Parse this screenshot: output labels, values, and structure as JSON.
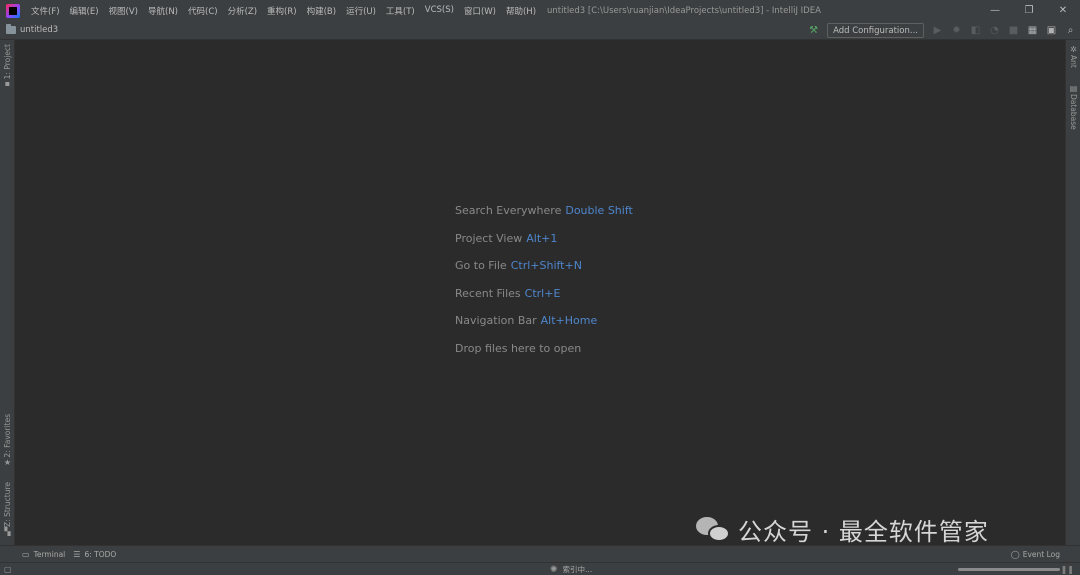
{
  "titlebar": {
    "menu": [
      "文件(F)",
      "编辑(E)",
      "视图(V)",
      "导航(N)",
      "代码(C)",
      "分析(Z)",
      "重构(R)",
      "构建(B)",
      "运行(U)",
      "工具(T)",
      "VCS(S)",
      "窗口(W)",
      "帮助(H)"
    ],
    "window_title": "untitled3 [C:\\Users\\ruanjian\\IdeaProjects\\untitled3] - IntelliJ IDEA",
    "minimize": "—",
    "restore": "❐",
    "close": "✕"
  },
  "navbar": {
    "project_name": "untitled3",
    "add_configuration": "Add Configuration..."
  },
  "left_strip": {
    "project_tab": "1: Project",
    "favorites_tab": "2: Favorites",
    "structure_tab": "Z: Structure"
  },
  "right_strip": {
    "ant_tab": "Ant",
    "database_tab": "Database"
  },
  "hints": [
    {
      "label": "Search Everywhere",
      "key": "Double Shift"
    },
    {
      "label": "Project View",
      "key": "Alt+1"
    },
    {
      "label": "Go to File",
      "key": "Ctrl+Shift+N"
    },
    {
      "label": "Recent Files",
      "key": "Ctrl+E"
    },
    {
      "label": "Navigation Bar",
      "key": "Alt+Home"
    },
    {
      "label": "Drop files here to open",
      "key": ""
    }
  ],
  "watermark": {
    "text": "公众号 · 最全软件管家"
  },
  "bottom_tabs": {
    "terminal": "Terminal",
    "todo": "6: TODO",
    "event_log": "Event Log"
  },
  "status": {
    "indexing": "索引中...",
    "progress_fraction": 1.0
  },
  "colors": {
    "background": "#2b2b2b",
    "chrome": "#3c3f41",
    "shortcut_blue": "#589df6",
    "build_green": "#59a869"
  },
  "icons": {
    "app_logo": "intellij-logo-icon",
    "build": "hammer-icon",
    "run": "run-icon",
    "debug": "debug-icon",
    "coverage": "coverage-icon",
    "profile": "profile-icon",
    "stop": "stop-icon",
    "project_structure": "project-structure-icon",
    "layout": "layout-icon",
    "search": "search-icon"
  }
}
